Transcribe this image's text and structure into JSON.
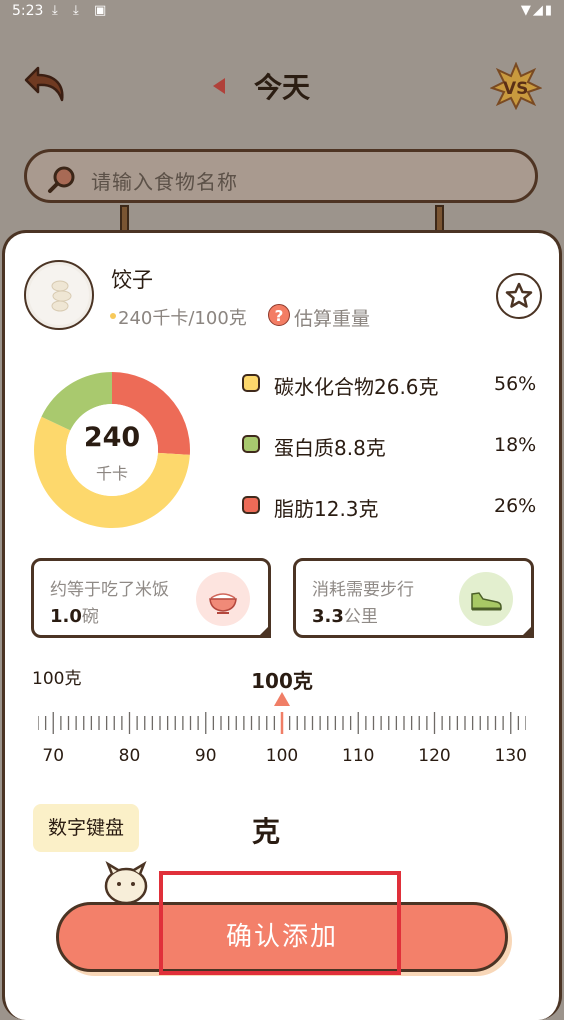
{
  "status_bar": {
    "time": "5:23",
    "icons": [
      "download-icon",
      "download-icon",
      "vpn-icon",
      "wifi-icon",
      "signal-icon",
      "battery-icon"
    ]
  },
  "header": {
    "title": "今天"
  },
  "search": {
    "placeholder": "请输入食物名称"
  },
  "food": {
    "name": "饺子",
    "calories_per_100g": "240千卡/100克",
    "estimate_label": "估算重量"
  },
  "donut": {
    "value": "240",
    "unit": "千卡"
  },
  "macros": [
    {
      "label": "碳水化合物26.6克",
      "pct": "56%",
      "color": "#fdd86c",
      "fraction": 0.56
    },
    {
      "label": "蛋白质8.8克",
      "pct": "18%",
      "color": "#a9c96e",
      "fraction": 0.18
    },
    {
      "label": "脂肪12.3克",
      "pct": "26%",
      "color": "#ed6b57",
      "fraction": 0.26
    }
  ],
  "cards": {
    "rice": {
      "title": "约等于吃了米饭",
      "value": "1.0",
      "unit": "碗"
    },
    "steps": {
      "title": "消耗需要步行",
      "value": "3.3",
      "unit": "公里"
    }
  },
  "weight": {
    "small_label": "100克",
    "current_label": "100克",
    "ruler_labels": [
      "70",
      "80",
      "90",
      "100",
      "110",
      "120",
      "130"
    ],
    "ruler_min": 68,
    "ruler_max": 132,
    "current": 100
  },
  "keypad_label": "数字键盘",
  "unit_label": "克",
  "confirm_label": "确认添加"
}
